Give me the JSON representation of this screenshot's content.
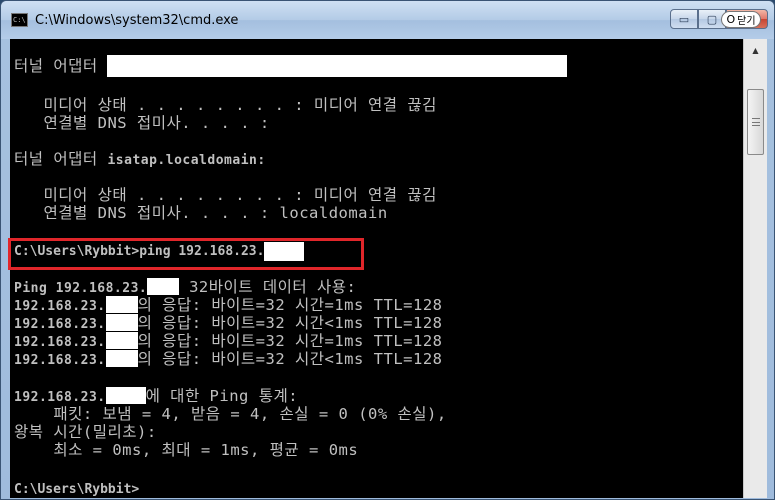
{
  "window": {
    "title": "C:\\Windows\\system32\\cmd.exe",
    "icon_text": "C:\\",
    "close_label": "닫기",
    "minimize_glyph": "▭",
    "maximize_glyph": "▢",
    "close_glyph": "O"
  },
  "console": {
    "lines": [
      {
        "id": "adapter1",
        "text": "터널 어댑터 "
      },
      {
        "id": "media1",
        "text": "   미디어 상태 . . . . . . . . : 미디어 연결 끊김"
      },
      {
        "id": "dns1",
        "text": "   연결별 DNS 접미사. . . . :"
      },
      {
        "id": "adapter2_prefix",
        "text": "터널 어댑터 "
      },
      {
        "id": "adapter2_name",
        "text": "isatap.localdomain:"
      },
      {
        "id": "media2",
        "text": "   미디어 상태 . . . . . . . . : 미디어 연결 끊김"
      },
      {
        "id": "dns2",
        "text": "   연결별 DNS 접미사. . . . : localdomain"
      },
      {
        "id": "cmd_ping",
        "text": "C:\\Users\\Rybbit>ping 192.168.23."
      },
      {
        "id": "ping_header_ip",
        "text": "Ping 192.168.23."
      },
      {
        "id": "ping_header_rest",
        "text": " 32바이트 데이터 사용:"
      },
      {
        "id": "ip_prefix",
        "text": "192.168.23."
      },
      {
        "id": "reply1",
        "text": "의 응답: 바이트=32 시간=1ms TTL=128"
      },
      {
        "id": "reply2",
        "text": "의 응답: 바이트=32 시간<1ms TTL=128"
      },
      {
        "id": "reply3",
        "text": "의 응답: 바이트=32 시간=1ms TTL=128"
      },
      {
        "id": "reply4",
        "text": "의 응답: 바이트=32 시간<1ms TTL=128"
      },
      {
        "id": "stats_rest",
        "text": "에 대한 Ping 통계:"
      },
      {
        "id": "packets",
        "text": "    패킷: 보냄 = 4, 받음 = 4, 손실 = 0 (0% 손실),"
      },
      {
        "id": "rtt",
        "text": "왕복 시간(밀리초):"
      },
      {
        "id": "minmax",
        "text": "    최소 = 0ms, 최대 = 1ms, 평균 = 0ms"
      },
      {
        "id": "prompt",
        "text": "C:\\Users\\Rybbit>"
      }
    ]
  },
  "colors": {
    "console_bg": "#000000",
    "console_text": "#c0c0c0",
    "highlight": "#e0262a"
  }
}
